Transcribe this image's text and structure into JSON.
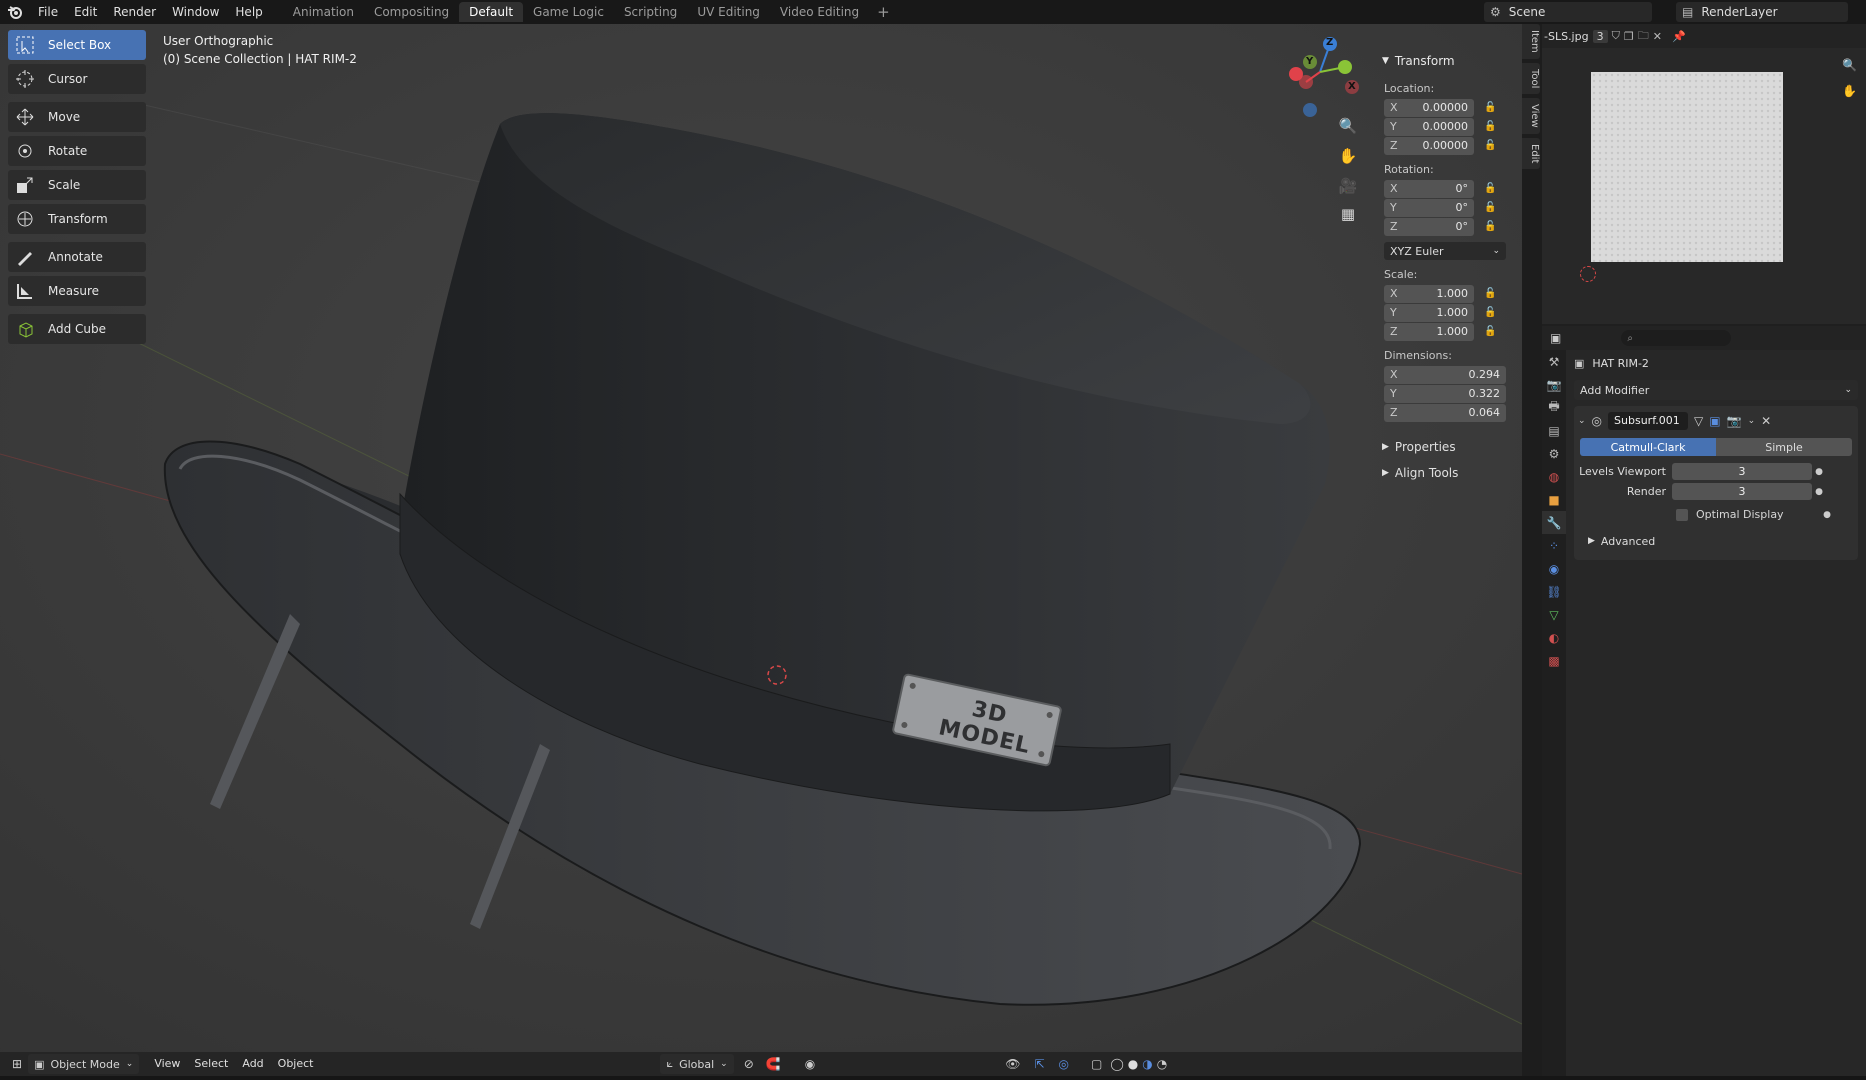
{
  "topbar": {
    "menu": [
      "File",
      "Edit",
      "Render",
      "Window",
      "Help"
    ],
    "workspaces": [
      "Animation",
      "Compositing",
      "Default",
      "Game Logic",
      "Scripting",
      "UV Editing",
      "Video Editing"
    ],
    "active_workspace": "Default",
    "add_workspace": "+",
    "scene": "Scene",
    "view_layer": "RenderLayer"
  },
  "toolbar": {
    "tools": [
      {
        "label": "Select Box",
        "icon": "select-box-icon",
        "active": true
      },
      {
        "label": "Cursor",
        "icon": "cursor-icon"
      },
      {
        "label": "Move",
        "icon": "move-icon"
      },
      {
        "label": "Rotate",
        "icon": "rotate-icon"
      },
      {
        "label": "Scale",
        "icon": "scale-icon"
      },
      {
        "label": "Transform",
        "icon": "transform-icon"
      },
      {
        "label": "Annotate",
        "icon": "annotate-icon"
      },
      {
        "label": "Measure",
        "icon": "measure-icon"
      },
      {
        "label": "Add Cube",
        "icon": "add-cube-icon"
      }
    ]
  },
  "viewport": {
    "view_name": "User Orthographic",
    "collection_info": "(0) Scene Collection | HAT RIM-2",
    "badge_text": "3D MODEL",
    "gizmo": {
      "z": "Z",
      "y": "Y",
      "x": "X"
    }
  },
  "npanel": {
    "tabs": [
      "Item",
      "Tool",
      "View",
      "Edit"
    ],
    "transform_title": "Transform",
    "location_label": "Location:",
    "location": [
      {
        "axis": "X",
        "value": "0.00000"
      },
      {
        "axis": "Y",
        "value": "0.00000"
      },
      {
        "axis": "Z",
        "value": "0.00000"
      }
    ],
    "rotation_label": "Rotation:",
    "rotation": [
      {
        "axis": "X",
        "value": "0°"
      },
      {
        "axis": "Y",
        "value": "0°"
      },
      {
        "axis": "Z",
        "value": "0°"
      }
    ],
    "rotation_mode": "XYZ Euler",
    "scale_label": "Scale:",
    "scale": [
      {
        "axis": "X",
        "value": "1.000"
      },
      {
        "axis": "Y",
        "value": "1.000"
      },
      {
        "axis": "Z",
        "value": "1.000"
      }
    ],
    "dimensions_label": "Dimensions:",
    "dimensions": [
      {
        "axis": "X",
        "value": "0.294"
      },
      {
        "axis": "Y",
        "value": "0.322"
      },
      {
        "axis": "Z",
        "value": "0.064"
      }
    ],
    "properties_label": "Properties",
    "align_tools_label": "Align Tools"
  },
  "image_editor": {
    "image_name": "-SLS.jpg",
    "users": "3"
  },
  "properties": {
    "object_name": "HAT RIM-2",
    "add_modifier": "Add Modifier",
    "modifier": {
      "name": "Subsurf.001",
      "mode_on": "Catmull-Clark",
      "mode_off": "Simple",
      "levels_viewport_label": "Levels Viewport",
      "levels_viewport": "3",
      "render_label": "Render",
      "render": "3",
      "optimal_display": "Optimal Display",
      "advanced": "Advanced"
    }
  },
  "statusbar": {
    "mode": "Object Mode",
    "menu": [
      "View",
      "Select",
      "Add",
      "Object"
    ],
    "orientation": "Global"
  },
  "colors": {
    "accent": "#4772b3",
    "axis_x": "#e0424a",
    "axis_y": "#8ac437",
    "axis_z": "#3a7fd6"
  }
}
